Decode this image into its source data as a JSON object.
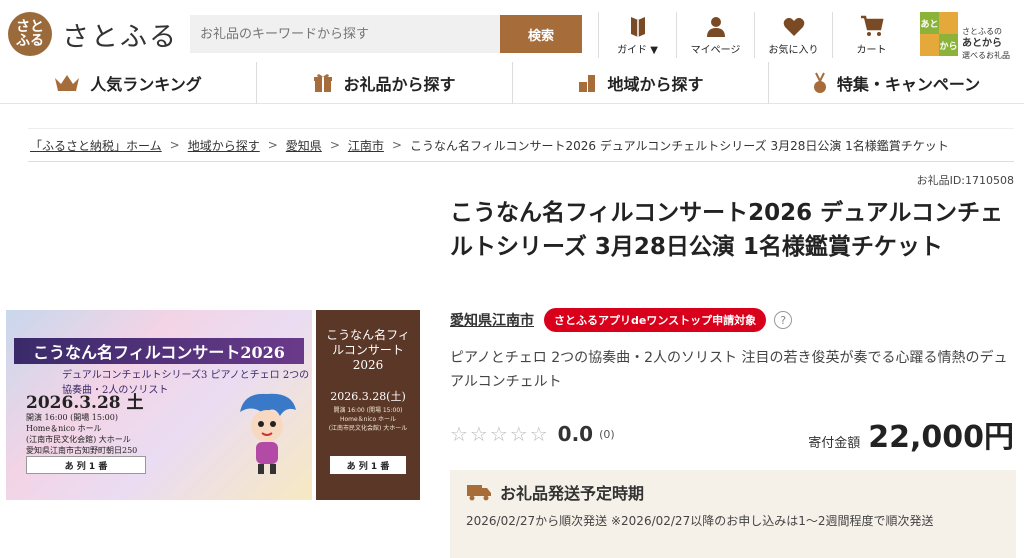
{
  "header": {
    "logo_text": "さとふる",
    "search_placeholder": "お礼品のキーワードから探す",
    "search_button": "検索",
    "icons": [
      {
        "label": "ガイド ▼",
        "icon": "guide-book-icon"
      },
      {
        "label": "マイページ",
        "icon": "user-icon"
      },
      {
        "label": "お気に入り",
        "icon": "heart-icon"
      },
      {
        "label": "カート",
        "icon": "cart-icon"
      }
    ],
    "app_banner": {
      "text1": "さとふるの",
      "text2": "あとから",
      "text3": "選べるお礼品",
      "tiles": [
        "あと",
        "から"
      ]
    }
  },
  "nav": [
    {
      "label": "人気ランキング",
      "icon": "crown-icon"
    },
    {
      "label": "お礼品から探す",
      "icon": "gift-icon"
    },
    {
      "label": "地域から探す",
      "icon": "buildings-icon"
    },
    {
      "label": "特集・キャンペーン",
      "icon": "medal-icon"
    }
  ],
  "breadcrumb": {
    "items": [
      "「ふるさと納税」ホーム",
      "地域から探す",
      "愛知県",
      "江南市"
    ],
    "current": "こうなん名フィルコンサート2026 デュアルコンチェルトシリーズ 3月28日公演 1名様鑑賞チケット",
    "separator": ">"
  },
  "gift_id": "お礼品ID:1710508",
  "product": {
    "title": "こうなん名フィルコンサート2026 デュアルコンチェルトシリーズ 3月28日公演 1名様鑑賞チケット",
    "municipality": "愛知県江南市",
    "badge": "さとふるアプリdeワンストップ申請対象",
    "help": "?",
    "description": "ピアノとチェロ 2つの協奏曲・2人のソリスト 注目の若き俊英が奏でる心躍る情熱のデュアルコンチェルト",
    "stars": "☆☆☆☆☆",
    "score": "0.0",
    "review_count": "(0)",
    "price_label": "寄付金額",
    "price": "22,000円"
  },
  "ticket_image": {
    "title": "こうなん名フィルコンサート2026",
    "subtitle": "デュアルコンチェルトシリーズ3 ピアノとチェロ 2つの協奏曲・2人のソリスト",
    "date": "2026.3.28 土",
    "info_lines": [
      "開演 16:00 (開場 15:00)",
      "Home＆nico ホール",
      "(江南市民文化会館) 大ホール",
      "愛知県江南市古知野町朝日250"
    ],
    "seat": "あ 列 1 番",
    "stub_title": "こうなん名フィルコンサート2026",
    "stub_date": "2026.3.28(土)",
    "stub_info": [
      "開演 16:00 (開場 15:00)",
      "Home＆nico ホール",
      "(江南市民文化会館) 大ホール"
    ],
    "stub_seat": "あ 列 1 番"
  },
  "shipping": {
    "heading": "お礼品発送予定時期",
    "text": "2026/02/27から順次発送 ※2026/02/27以降のお申し込みは1～2週間程度で順次発送"
  },
  "colors": {
    "brand": "#a66d3b",
    "badge": "#d9001b",
    "ship_bg": "#f5f1e8"
  }
}
